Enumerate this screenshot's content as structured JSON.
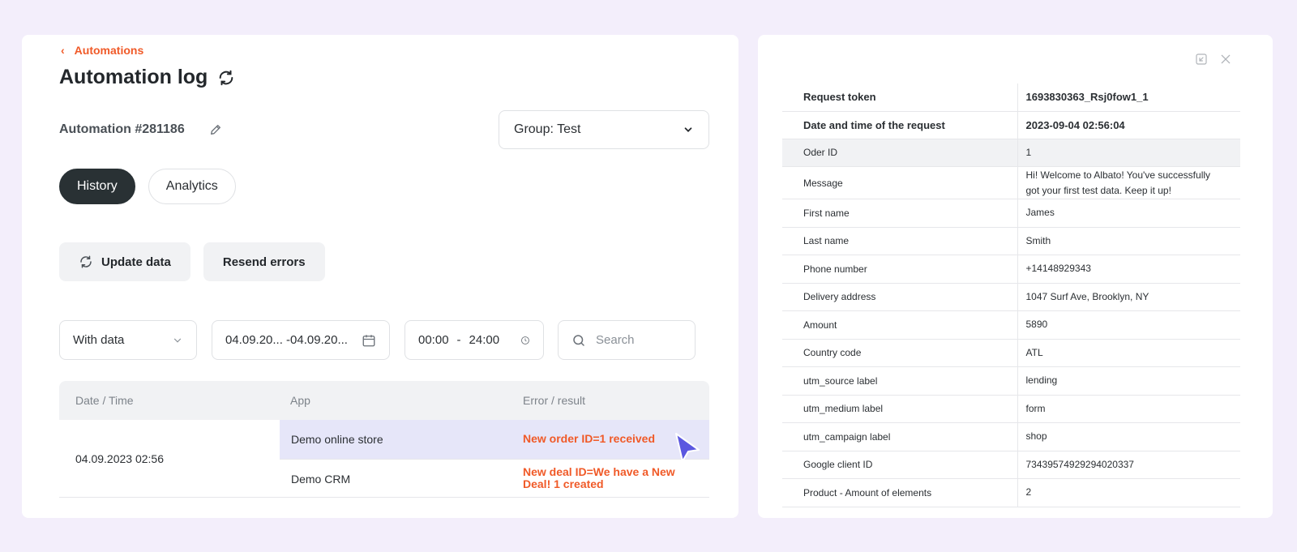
{
  "breadcrumb": {
    "label": "Automations"
  },
  "page": {
    "title": "Automation log"
  },
  "automation": {
    "name": "Automation #281186"
  },
  "group_select": {
    "value": "Group: Test"
  },
  "tabs": [
    {
      "label": "History",
      "active": true
    },
    {
      "label": "Analytics",
      "active": false
    }
  ],
  "actions": {
    "update_label": "Update data",
    "resend_label": "Resend errors"
  },
  "filters": {
    "data_filter": "With data",
    "date_range": "04.09.20... -04.09.20...",
    "time_from": "00:00",
    "time_sep": "-",
    "time_to": "24:00",
    "search_placeholder": "Search"
  },
  "log_table": {
    "headers": [
      "Date / Time",
      "App",
      "Error / result"
    ],
    "date": "04.09.2023 02:56",
    "rows": [
      {
        "app": "Demo online store",
        "result": "New order ID=1 received"
      },
      {
        "app": "Demo CRM",
        "result": "New deal ID=We have a New Deal! 1 created"
      }
    ]
  },
  "details": {
    "header_rows": [
      {
        "key": "Request token",
        "value": "1693830363_Rsj0fow1_1"
      },
      {
        "key": "Date and time of the request",
        "value": "2023-09-04 02:56:04"
      }
    ],
    "rows": [
      {
        "key": "Oder ID",
        "value": "1"
      },
      {
        "key": "Message",
        "value": "Hi! Welcome to Albato! You've successfully got your first test data. Keep it up!"
      },
      {
        "key": "First name",
        "value": "James"
      },
      {
        "key": "Last name",
        "value": "Smith"
      },
      {
        "key": "Phone number",
        "value": "+14148929343"
      },
      {
        "key": "Delivery address",
        "value": "1047 Surf Ave, Brooklyn, NY"
      },
      {
        "key": "Amount",
        "value": "5890"
      },
      {
        "key": "Country code",
        "value": "ATL"
      },
      {
        "key": "utm_source label",
        "value": "lending"
      },
      {
        "key": "utm_medium label",
        "value": "form"
      },
      {
        "key": "utm_campaign label",
        "value": "shop"
      },
      {
        "key": "Google client ID",
        "value": "73439574929294020337"
      },
      {
        "key": "Product - Amount of elements",
        "value": "2"
      }
    ]
  },
  "colors": {
    "accent": "#f05a28",
    "dark": "#293134",
    "highlight": "#e6e6f9",
    "cursor": "#5b57e0"
  }
}
